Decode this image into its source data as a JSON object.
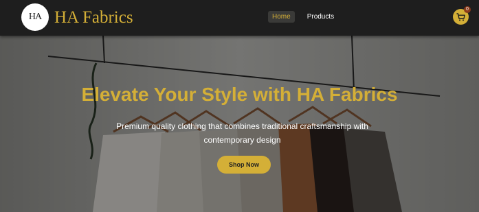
{
  "header": {
    "logo_text": "HA",
    "brand_name": "HA Fabrics",
    "nav": [
      {
        "label": "Home",
        "active": true
      },
      {
        "label": "Products",
        "active": false
      }
    ],
    "cart_count": "0",
    "cart_icon": "shopping-cart-icon"
  },
  "hero": {
    "title": "Elevate Your Style with HA Fabrics",
    "subtitle": "Premium quality clothing that combines traditional craftsmanship with contemporary design",
    "cta_label": "Shop Now",
    "background": "clothes-on-hangers-photo"
  },
  "colors": {
    "accent": "#d4af37",
    "header_bg": "#1e1e1e",
    "active_nav_bg": "#3a3a38",
    "badge": "#8b3a1a"
  }
}
